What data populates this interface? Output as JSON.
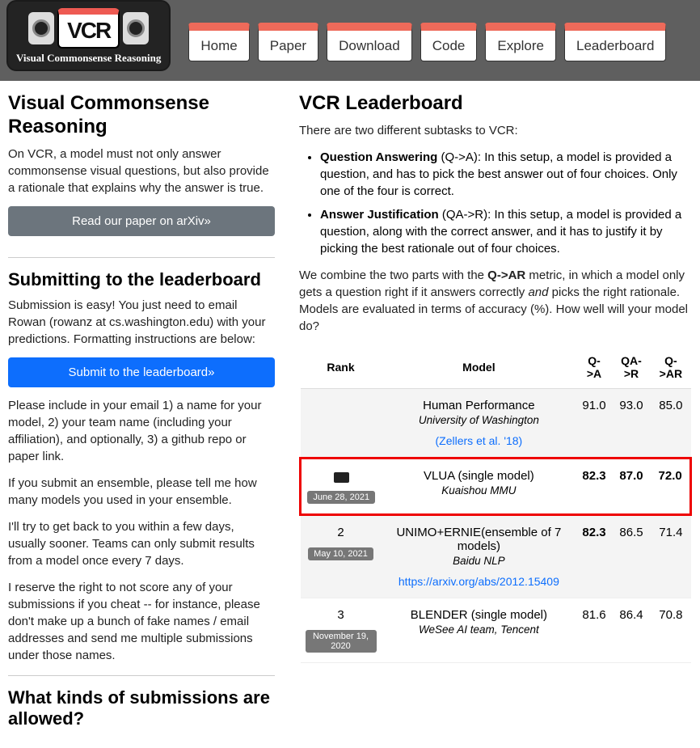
{
  "logo": {
    "abbrev": "VCR",
    "subtitle": "Visual Commonsense Reasoning"
  },
  "nav": [
    "Home",
    "Paper",
    "Download",
    "Code",
    "Explore",
    "Leaderboard"
  ],
  "left": {
    "title": "Visual Commonsense Reasoning",
    "intro": "On VCR, a model must not only answer commonsense visual questions, but also provide a rationale that explains why the answer is true.",
    "paper_btn": "Read our paper on arXiv»",
    "submit_title": "Submitting to the leaderboard",
    "submit_p1": "Submission is easy! You just need to email Rowan (rowanz at cs.washington.edu) with your predictions. Formatting instructions are below:",
    "submit_btn": "Submit to the leaderboard»",
    "submit_p2": "Please include in your email 1) a name for your model, 2) your team name (including your affiliation), and optionally, 3) a github repo or paper link.",
    "submit_p3": "If you submit an ensemble, please tell me how many models you used in your ensemble.",
    "submit_p4": "I'll try to get back to you within a few days, usually sooner. Teams can only submit results from a model once every 7 days.",
    "submit_p5": "I reserve the right to not score any of your submissions if you cheat -- for instance, please don't make up a bunch of fake names / email addresses and send me multiple submissions under those names.",
    "kinds_title": "What kinds of submissions are allowed?"
  },
  "right": {
    "title": "VCR Leaderboard",
    "subtasks_intro": "There are two different subtasks to VCR:",
    "qa_label": "Question Answering",
    "qa_text": " (Q->A): In this setup, a model is provided a question, and has to pick the best answer out of four choices. Only one of the four is correct.",
    "aj_label": "Answer Justification",
    "aj_text": " (QA->R): In this setup, a model is provided a question, along with the correct answer, and it has to justify it by picking the best rationale out of four choices.",
    "combine_a": "We combine the two parts with the ",
    "combine_metric": "Q->AR",
    "combine_b": " metric, in which a model only gets a question right if it answers correctly ",
    "combine_and": "and",
    "combine_c": " picks the right rationale. Models are evaluated in terms of accuracy (%). How well will your model do?",
    "headers": {
      "rank": "Rank",
      "model": "Model",
      "qa": "Q->A",
      "qar": "QA->R",
      "qar2": "Q->AR"
    },
    "rows": [
      {
        "model": "Human Performance",
        "sub": "University of Washington",
        "link": "(Zellers et al. '18)",
        "qa": "91.0",
        "qar": "93.0",
        "qar2": "85.0",
        "bold": false,
        "striped": true
      },
      {
        "rank_badge": true,
        "date": "June 28, 2021",
        "model": "VLUA (single model)",
        "sub": "Kuaishou MMU",
        "qa": "82.3",
        "qar": "87.0",
        "qar2": "72.0",
        "bold": true,
        "highlight": true
      },
      {
        "rank": "2",
        "date": "May 10, 2021",
        "model": "UNIMO+ERNIE(ensemble of 7 models)",
        "sub": "Baidu NLP",
        "link": "https://arxiv.org/abs/2012.15409",
        "qa": "82.3",
        "qar": "86.5",
        "qar2": "71.4",
        "bold_qa": true,
        "striped": true
      },
      {
        "rank": "3",
        "date": "November 19, 2020",
        "model": "BLENDER (single model)",
        "sub": "WeSee AI team, Tencent",
        "qa": "81.6",
        "qar": "86.4",
        "qar2": "70.8"
      }
    ]
  }
}
